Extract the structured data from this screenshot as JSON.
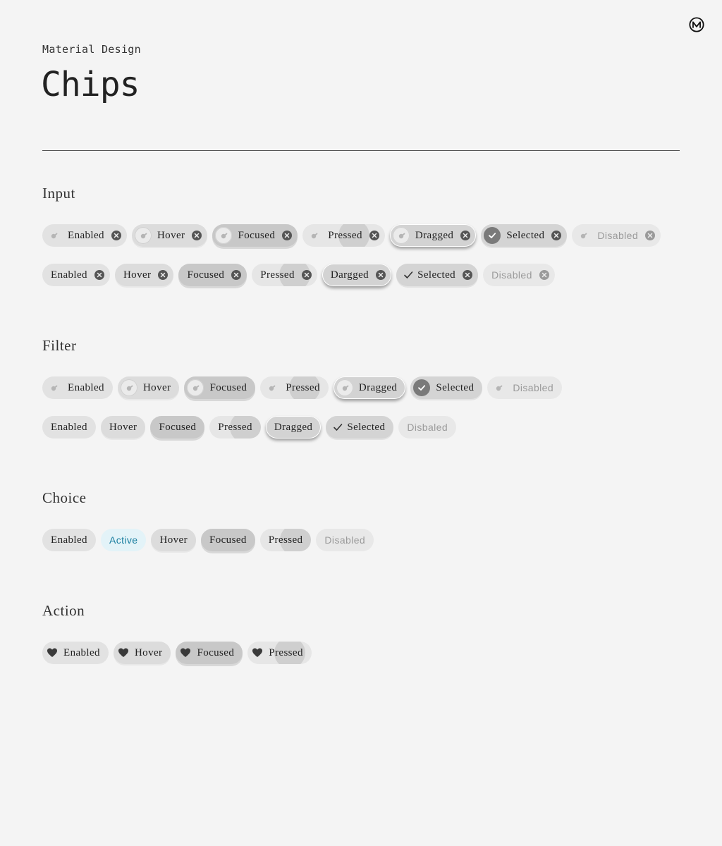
{
  "header": {
    "eyebrow": "Material Design",
    "title": "Chips",
    "logo_icon": "material-logo-icon"
  },
  "colors": {
    "background": "#f4f4f4",
    "chip": "#e2e2e2",
    "focused": "#c8c8c8",
    "active_bg": "#e3f3f8",
    "active_text": "#1a7fa0",
    "icon": "#555555"
  },
  "input": {
    "title": "Input",
    "row1": [
      {
        "label": "Enabled",
        "state": "enabled"
      },
      {
        "label": "Hover",
        "state": "hover"
      },
      {
        "label": "Focused",
        "state": "focused"
      },
      {
        "label": "Pressed",
        "state": "pressed"
      },
      {
        "label": "Dragged",
        "state": "dragged"
      },
      {
        "label": "Selected",
        "state": "selected"
      },
      {
        "label": "Disabled",
        "state": "disabled"
      }
    ],
    "row2": [
      {
        "label": "Enabled",
        "state": "enabled"
      },
      {
        "label": "Hover",
        "state": "hover"
      },
      {
        "label": "Focused",
        "state": "focused"
      },
      {
        "label": "Pressed",
        "state": "pressed"
      },
      {
        "label": "Dargged",
        "state": "dragged"
      },
      {
        "label": "Selected",
        "state": "selected"
      },
      {
        "label": "Disabled",
        "state": "disabled"
      }
    ]
  },
  "filter": {
    "title": "Filter",
    "row1": [
      {
        "label": "Enabled",
        "state": "enabled"
      },
      {
        "label": "Hover",
        "state": "hover"
      },
      {
        "label": "Focused",
        "state": "focused"
      },
      {
        "label": "Pressed",
        "state": "pressed"
      },
      {
        "label": "Dragged",
        "state": "dragged"
      },
      {
        "label": "Selected",
        "state": "selected"
      },
      {
        "label": "Disabled",
        "state": "disabled"
      }
    ],
    "row2": [
      {
        "label": "Enabled",
        "state": "enabled"
      },
      {
        "label": "Hover",
        "state": "hover"
      },
      {
        "label": "Focused",
        "state": "focused"
      },
      {
        "label": "Pressed",
        "state": "pressed"
      },
      {
        "label": "Dragged",
        "state": "dragged"
      },
      {
        "label": "Selected",
        "state": "selected"
      },
      {
        "label": "Disbaled",
        "state": "disabled"
      }
    ]
  },
  "choice": {
    "title": "Choice",
    "row1": [
      {
        "label": "Enabled",
        "state": "enabled"
      },
      {
        "label": "Active",
        "state": "active"
      },
      {
        "label": "Hover",
        "state": "hover"
      },
      {
        "label": "Focused",
        "state": "focused"
      },
      {
        "label": "Pressed",
        "state": "pressed"
      },
      {
        "label": "Disabled",
        "state": "disabled"
      }
    ]
  },
  "action": {
    "title": "Action",
    "row1": [
      {
        "label": "Enabled",
        "state": "enabled"
      },
      {
        "label": "Hover",
        "state": "hover"
      },
      {
        "label": "Focused",
        "state": "focused"
      },
      {
        "label": "Pressed",
        "state": "pressed"
      }
    ]
  }
}
